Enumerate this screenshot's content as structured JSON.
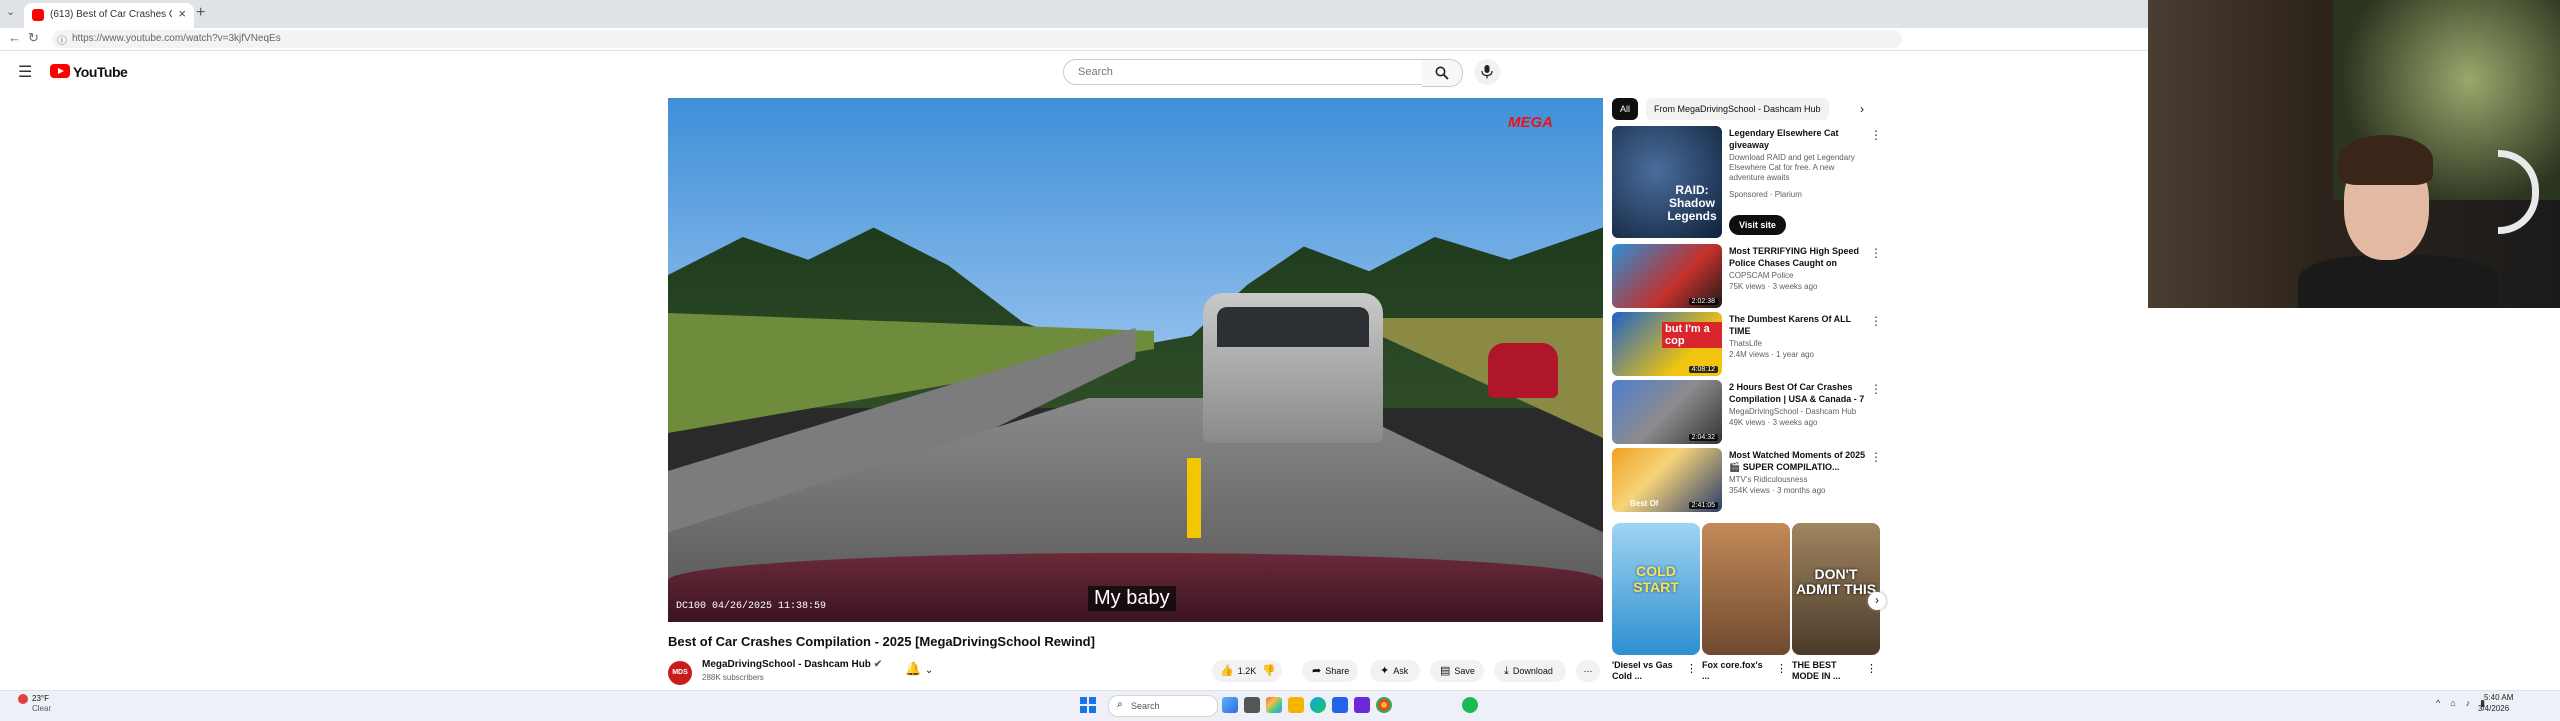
{
  "browser": {
    "tab_title": "(613) Best of Car Crashes Co",
    "url": "https://www.youtube.com/watch?v=3kjfVNeqEs"
  },
  "header": {
    "logo": "YouTube",
    "search_placeholder": "Search"
  },
  "video": {
    "watermark": "MEGA",
    "dashcam_stamp": "DC100 04/26/2025 11:38:59",
    "caption": "My baby",
    "title": "Best of Car Crashes Compilation - 2025 [MegaDrivingSchool Rewind]",
    "channel": "MegaDrivingSchool - Dashcam Hub",
    "channel_avatar": "MDS",
    "subscribers": "288K subscribers",
    "likes": "1.2K",
    "share_label": "Share",
    "ask_label": "Ask",
    "save_label": "Save",
    "download_label": "Download"
  },
  "sidebar": {
    "chips": [
      "All",
      "From MegaDrivingSchool - Dashcam Hub"
    ],
    "ad": {
      "title": "Legendary Elsewhere Cat giveaway",
      "desc": "Download RAID and get Legendary Elsewhere Cat for free. A new adventure awaits",
      "sponsored": "Sponsored · Plarium",
      "thumb_text": "RAID: Shadow Legends",
      "button": "Visit site"
    },
    "recs": [
      {
        "title": "Most TERRIFYING High Speed Police Chases Caught on Dash...",
        "channel": "COPSCAM Police",
        "meta": "75K views · 3 weeks ago",
        "duration": "2:02:38"
      },
      {
        "title": "The Dumbest Karens Of ALL TIME",
        "channel": "ThatsLife",
        "meta": "2.4M views · 1 year ago",
        "duration": "4:08:12",
        "thumb_text": "but I'm a cop"
      },
      {
        "title": "2 Hours Best Of Car Crashes Compilation | USA & Canada - 7",
        "channel": "MegaDrivingSchool - Dashcam Hub",
        "meta": "49K views · 3 weeks ago",
        "duration": "2:04:32"
      },
      {
        "title": "Most Watched Moments of 2025 🎬 SUPER COMPILATIO...",
        "channel": "MTV's Ridiculousness",
        "meta": "354K views · 3 months ago",
        "duration": "2:41:05",
        "thumb_text": "Best Of"
      }
    ],
    "shorts": [
      {
        "big": "COLD START",
        "title": "'Diesel vs Gas Cold ..."
      },
      {
        "big": "",
        "title": "Fox core.fox's ..."
      },
      {
        "big": "DON'T ADMIT THIS",
        "title": "THE BEST MODE IN ..."
      }
    ]
  },
  "taskbar": {
    "weather_temp": "23°F",
    "weather_desc": "Clear",
    "search_label": "Search",
    "time": "5:40 AM",
    "date": "3/4/2026"
  },
  "colors": {
    "youtube_red": "#ff0000",
    "mega_red": "#e8141c"
  }
}
